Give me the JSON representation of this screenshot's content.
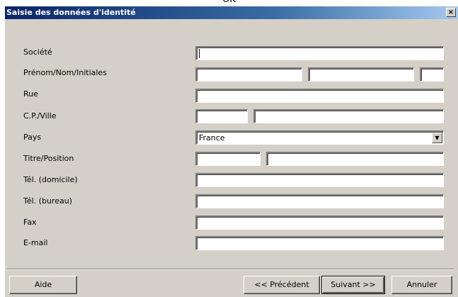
{
  "top_text": "OK",
  "dialog": {
    "title": "Saisie des données d'identité",
    "close_label": "×"
  },
  "labels": {
    "societe": "Société",
    "prenom": "Prénom/Nom/Initiales",
    "rue": "Rue",
    "cp": "C.P./Ville",
    "pays": "Pays",
    "titre": "Titre/Position",
    "tel_dom": "Tél. (domicile)",
    "tel_bur": "Tél. (bureau)",
    "fax": "Fax",
    "email": "E-mail"
  },
  "values": {
    "pays": "France"
  },
  "buttons": {
    "aide": "Aide",
    "precedent": "<< Précédent",
    "suivant": "Suivant >>",
    "annuler": "Annuler"
  }
}
